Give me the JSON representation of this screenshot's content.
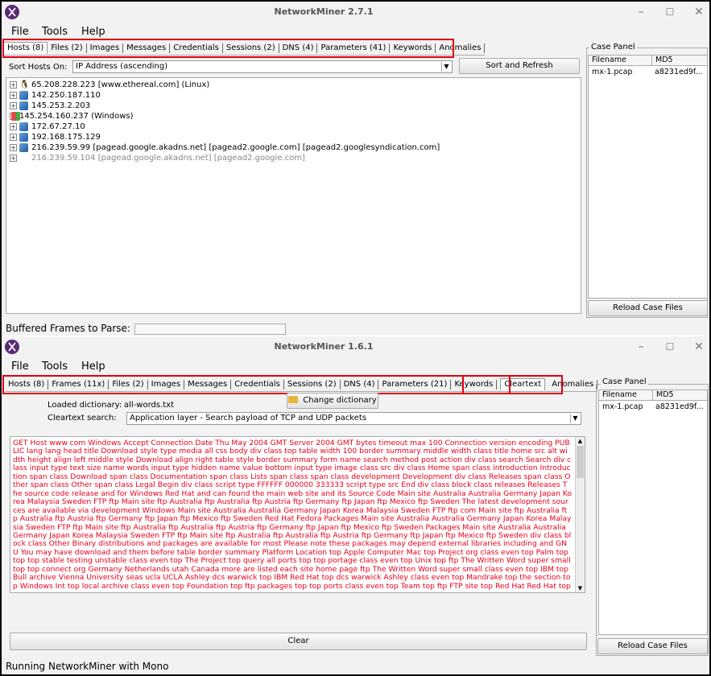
{
  "window1": {
    "title": "NetworkMiner 2.7.1",
    "menu": [
      "File",
      "Tools",
      "Help"
    ],
    "tabs": [
      "Hosts (8)",
      "Files (2)",
      "Images",
      "Messages",
      "Credentials",
      "Sessions (2)",
      "DNS (4)",
      "Parameters (41)",
      "Keywords",
      "Anomalies"
    ],
    "sort_label": "Sort Hosts On:",
    "sort_value": "IP Address (ascending)",
    "sort_button": "Sort and Refresh",
    "hosts": [
      {
        "text": "65.208.228.223 [www.ethereal.com] (Linux)",
        "icon": "linux-icon"
      },
      {
        "text": "142.250.187.110",
        "icon": "computer-icon"
      },
      {
        "text": "145.253.2.203",
        "icon": "computer-icon"
      },
      {
        "text": "145.254.160.237 (Windows)",
        "icon": "windows-icon"
      },
      {
        "text": "172.67.27.10",
        "icon": "computer-icon"
      },
      {
        "text": "192.168.175.129",
        "icon": "computer-icon"
      },
      {
        "text": "216.239.59.99 [pagead.google.akadns.net] [pagead2.google.com] [pagead2.googlesyndication.com]",
        "icon": "computer-icon"
      },
      {
        "text": "216.239.59.104 [pagead.google.akadns.net] [pagead2.google.com]",
        "icon": "none"
      }
    ],
    "case_panel": {
      "title": "Case Panel",
      "col_filename": "Filename",
      "col_md5": "MD5",
      "file": "mx-1.pcap",
      "md5": "a8231ed9f...",
      "reload": "Reload Case Files"
    },
    "status_label": "Buffered Frames to Parse:"
  },
  "window2": {
    "title": "NetworkMiner 1.6.1",
    "menu": [
      "File",
      "Tools",
      "Help"
    ],
    "tabs": [
      "Hosts (8)",
      "Frames (11x)",
      "Files (2)",
      "Images",
      "Messages",
      "Credentials",
      "Sessions (2)",
      "DNS (4)",
      "Parameters (21)",
      "Keywords"
    ],
    "tab_cleartext": "Cleartext",
    "tab_anomalies": "Anomalies",
    "loaded_dict_label": "Loaded dictionary:",
    "loaded_dict_value": "all-words.txt",
    "change_dict_button": "Change dictionary",
    "search_label": "Cleartext search:",
    "search_value": "Application layer - Search payload of TCP and UDP packets",
    "payload_text": "GET Host www com Windows Accept Connection Date Thu May 2004 GMT Server 2004 GMT bytes timeout max 100 Connection version encoding PUBLIC lang lang head title Download style type media all css body div class top table width 100 border summary middle width class title home src alt width height align left middle style Download align right table style border summary form name search method post action div class search Search div class input type text size name words input type hidden name value bottom input type image class src div class Home span class introduction Introduction span class Download span class Documentation span class Lists span class span class development Development div class Releases span class Other span class Other span class Legal Begin div class script type FFFFFF 000000 333333 script type src End div class block class releases Releases The source code release and for Windows Red Hat and can found the main web site and its Source Code Main site Australia Australia Germany Japan Korea Malaysia Sweden FTP ftp Main site ftp Australia ftp Australia ftp Austria ftp Germany ftp Japan ftp Mexico ftp Sweden The latest development sources are available via development Windows Main site Australia Australia Germany Japan Korea Malaysia Sweden FTP ftp com Main site ftp Australia ftp Australia ftp Austria ftp Germany ftp Japan ftp Mexico ftp Sweden Red Hat Fedora Packages Main site Australia Australia Germany Japan Korea Malaysia Sweden FTP ftp Main site ftp Australia ftp Australia ftp Austria ftp Germany ftp Japan ftp Mexico ftp Sweden Packages Main site Australia Australia Germany Japan Korea Malaysia Sweden FTP ftp Main site ftp Australia ftp Australia ftp Austria ftp Germany ftp Japan ftp Mexico ftp Sweden div class block class Other Binary distributions and packages are available for most Please note these packages may depend external libraries including and GNU You may have download and them before table border summary Platform Location top Apple Computer Mac top Project org class even top Palm top top top stable testing unstable class even top The Project top query all ports top top portage class even top Unix top ftp The Written Word super small top top connect org Germany Netherlands utah Canada more are listed each site home page ftp The Written Word super small class even top IBM top Bull archive Vienna University seas ucla UCLA Ashley dcs warwick top IBM Red Hat top dcs warwick Ashley class even top Mandrake top the section top Windows Int top local archive class even top Foundation top ftp packages top top ports class even top Team top ftp FTP site top Red Hat Red Hat top requires ftp",
    "clear_button": "Clear",
    "case_panel": {
      "title": "Case Panel",
      "col_filename": "Filename",
      "col_md5": "MD5",
      "file": "mx-1.pcap",
      "md5": "a8231ed9f...",
      "reload": "Reload Case Files"
    },
    "status_text": "Running NetworkMiner with Mono"
  },
  "colors": {
    "highlight_box": "#e0000f",
    "payload_text": "#e8001b",
    "logo": "#5a2a74"
  }
}
